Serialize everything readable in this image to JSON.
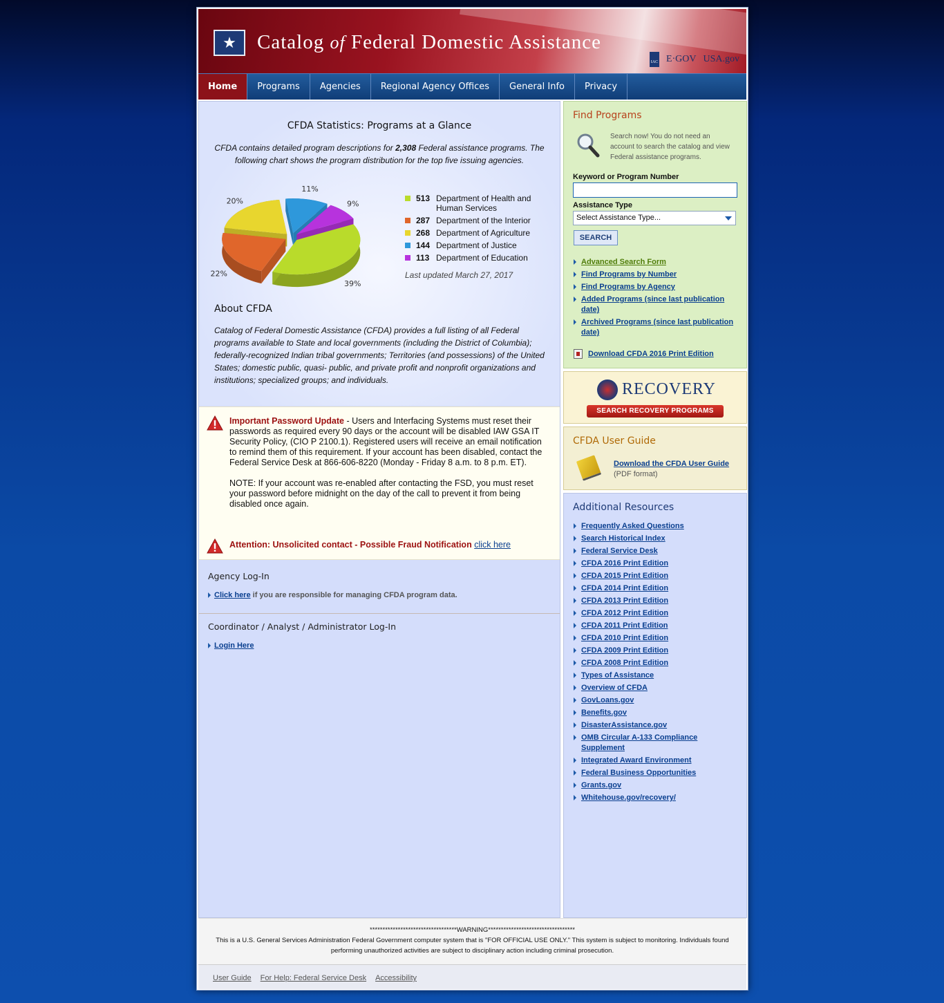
{
  "header": {
    "title_catalog": "Catalog",
    "title_of": "of",
    "title_rest": "Federal Domestic Assistance",
    "partners": {
      "iac": "IAC",
      "egov": "E·GOV",
      "usagov": "USA.gov"
    }
  },
  "nav": {
    "items": [
      {
        "label": "Home",
        "active": true
      },
      {
        "label": "Programs"
      },
      {
        "label": "Agencies"
      },
      {
        "label": "Regional Agency Offices"
      },
      {
        "label": "General Info"
      },
      {
        "label": "Privacy"
      }
    ]
  },
  "stats": {
    "heading": "CFDA Statistics: Programs at a Glance",
    "intro_pre": "CFDA contains detailed program descriptions for ",
    "intro_count": "2,308",
    "intro_post": " Federal assistance programs. The following chart shows the program distribution for the top five issuing agencies.",
    "updated": "Last updated March 27, 2017"
  },
  "chart_data": {
    "type": "pie",
    "categories": [
      "Department of Health and Human Services",
      "Department of the Interior",
      "Department of Agriculture",
      "Department of Justice",
      "Department of Education"
    ],
    "values": [
      513,
      287,
      268,
      144,
      113
    ],
    "slice_labels": [
      "39%",
      "22%",
      "20%",
      "11%",
      "9%"
    ],
    "colors": [
      "#b9db2b",
      "#e0662b",
      "#e8d62e",
      "#2e98db",
      "#b733dd"
    ]
  },
  "about": {
    "heading": "About CFDA",
    "text": "Catalog of Federal Domestic Assistance (CFDA) provides a full listing of all Federal programs available to State and local governments (including the District of Columbia); federally-recognized Indian tribal governments; Territories (and possessions) of the United States; domestic public, quasi- public, and private profit and nonprofit organizations and institutions; specialized groups; and individuals."
  },
  "notice": {
    "pw_title": "Important Password Update",
    "pw_text": " - Users and Interfacing Systems must reset their passwords as required every 90 days or the account will be disabled IAW GSA IT Security Policy, (CIO P 2100.1). Registered users will receive an email notification to remind them of this requirement. If your account has been disabled, contact the Federal Service Desk at 866-606-8220 (Monday - Friday 8 a.m. to 8 p.m. ET).",
    "pw_note": "NOTE: If your account was re-enabled after contacting the FSD, you must reset your password before midnight on the day of the call to prevent it from being disabled once again.",
    "fraud_title": "Attention: Unsolicited contact - Possible Fraud Notification",
    "fraud_link": "click here"
  },
  "login": {
    "agency_title": "Agency Log-In",
    "agency_link": "Click here",
    "agency_text": " if you are responsible for managing CFDA program data.",
    "coord_title": "Coordinator / Analyst / Administrator Log-In",
    "coord_link": "Login Here"
  },
  "find": {
    "heading": "Find Programs",
    "desc": "Search now! You do not need an account to search the catalog and view Federal assistance programs.",
    "keyword_label": "Keyword or Program Number",
    "keyword_value": "",
    "type_label": "Assistance Type",
    "type_selected": "Select Assistance Type...",
    "search_btn": "SEARCH",
    "links": [
      "Advanced Search Form",
      "Find Programs by Number",
      "Find Programs by Agency",
      "Added Programs (since last publication date)",
      "Archived Programs (since last publication date)"
    ],
    "download": "Download CFDA 2016 Print Edition"
  },
  "recovery": {
    "title": "RECOVERY",
    "button": "SEARCH RECOVERY PROGRAMS"
  },
  "guide": {
    "heading": "CFDA User Guide",
    "link": "Download the CFDA User Guide",
    "format": "(PDF format)"
  },
  "resources": {
    "heading": "Additional Resources",
    "links": [
      "Frequently Asked Questions",
      "Search Historical Index",
      "Federal Service Desk",
      "CFDA 2016 Print Edition",
      "CFDA 2015 Print Edition",
      "CFDA 2014 Print Edition",
      "CFDA 2013 Print Edition",
      "CFDA 2012 Print Edition",
      "CFDA 2011 Print Edition",
      "CFDA 2010 Print Edition",
      "CFDA 2009 Print Edition",
      "CFDA 2008 Print Edition",
      "Types of Assistance",
      "Overview of CFDA",
      "GovLoans.gov",
      "Benefits.gov",
      "DisasterAssistance.gov",
      "OMB Circular A-133 Compliance Supplement",
      "Integrated Award Environment",
      "Federal Business Opportunities",
      "Grants.gov",
      "Whitehouse.gov/recovery/"
    ]
  },
  "footer": {
    "warning": "**********************************WARNING**********************************",
    "text": "This is a U.S. General Services Administration Federal Government computer system that is \"FOR OFFICIAL USE ONLY.\" This system is subject to monitoring. Individuals found performing unauthorized activities are subject to disciplinary action including criminal prosecution.",
    "links": [
      "User Guide",
      "For Help: Federal Service Desk",
      "Accessibility"
    ]
  }
}
